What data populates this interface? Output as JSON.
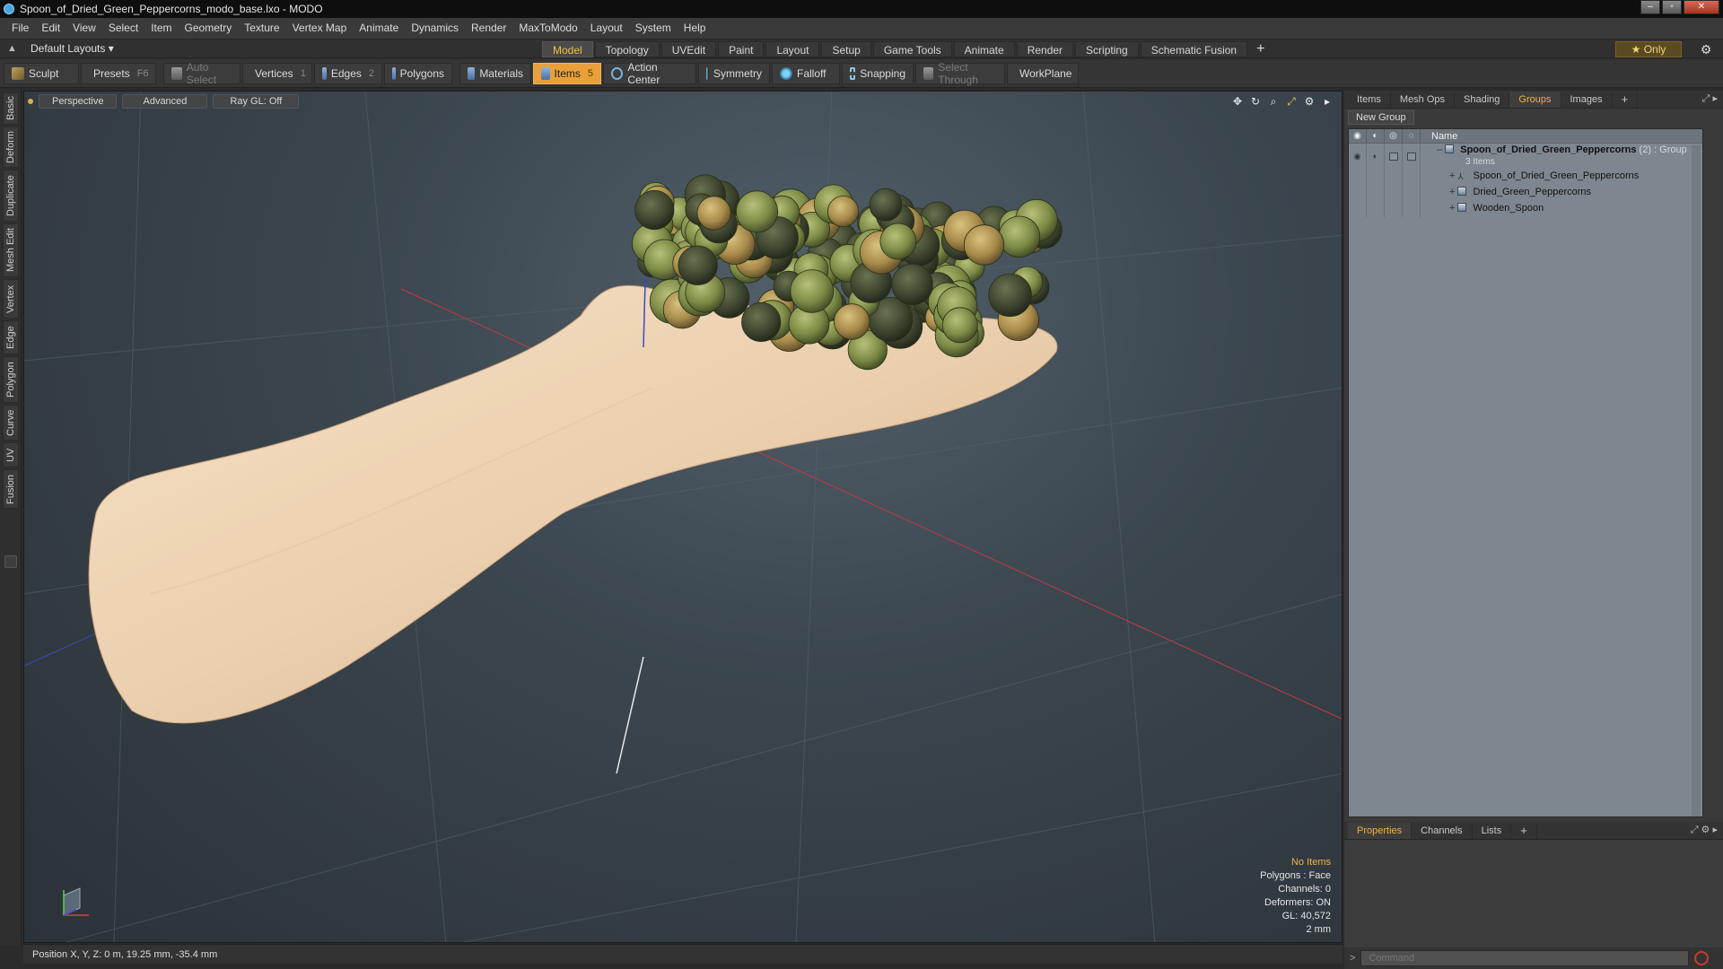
{
  "window": {
    "title": "Spoon_of_Dried_Green_Peppercorns_modo_base.lxo - MODO"
  },
  "menu": [
    "File",
    "Edit",
    "View",
    "Select",
    "Item",
    "Geometry",
    "Texture",
    "Vertex Map",
    "Animate",
    "Dynamics",
    "Render",
    "MaxToModo",
    "Layout",
    "System",
    "Help"
  ],
  "layoutbar": {
    "layout_select": "Default Layouts ▾",
    "tabs": [
      "Model",
      "Topology",
      "UVEdit",
      "Paint",
      "Layout",
      "Setup",
      "Game Tools",
      "Animate",
      "Render",
      "Scripting",
      "Schematic Fusion"
    ],
    "active_tab": "Model",
    "plus": "+",
    "only": "★  Only"
  },
  "toolbar": {
    "sculpt": "Sculpt",
    "presets": "Presets",
    "presets_key": "F6",
    "auto_select": "Auto Select",
    "vertices": "Vertices",
    "vertices_key": "1",
    "edges": "Edges",
    "edges_key": "2",
    "polygons": "Polygons",
    "materials": "Materials",
    "items": "Items",
    "items_key": "5",
    "action_center": "Action Center",
    "symmetry": "Symmetry",
    "falloff": "Falloff",
    "snapping": "Snapping",
    "select_through": "Select Through",
    "workplane": "WorkPlane"
  },
  "left_tabs": [
    "Basic",
    "Deform",
    "Duplicate",
    "Mesh Edit",
    "Vertex",
    "Edge",
    "Polygon",
    "Curve",
    "UV",
    "Fusion"
  ],
  "viewport": {
    "perspective": "Perspective",
    "advanced": "Advanced",
    "raygl": "Ray GL: Off",
    "info": {
      "no_items": "No Items",
      "polygons": "Polygons : Face",
      "channels": "Channels: 0",
      "deformers": "Deformers: ON",
      "gl": "GL: 40,572",
      "scale": "2 mm"
    }
  },
  "statusbar": {
    "position": "Position X, Y, Z:  0 m, 19.25 mm, -35.4 mm"
  },
  "right_panel": {
    "tabs": [
      "Items",
      "Mesh Ops",
      "Shading",
      "Groups",
      "Images"
    ],
    "active_tab": "Groups",
    "plus": "+",
    "new_group": "New Group",
    "name_header": "Name",
    "group": {
      "name": "Spoon_of_Dried_Green_Peppercorns",
      "count": "(2)",
      "type": ": Group",
      "subtitle": "3 Items"
    },
    "children": [
      "Spoon_of_Dried_Green_Peppercorns",
      "Dried_Green_Peppercorns",
      "Wooden_Spoon"
    ]
  },
  "properties": {
    "tabs": [
      "Properties",
      "Channels",
      "Lists"
    ],
    "active_tab": "Properties",
    "plus": "+",
    "command_placeholder": "Command"
  }
}
